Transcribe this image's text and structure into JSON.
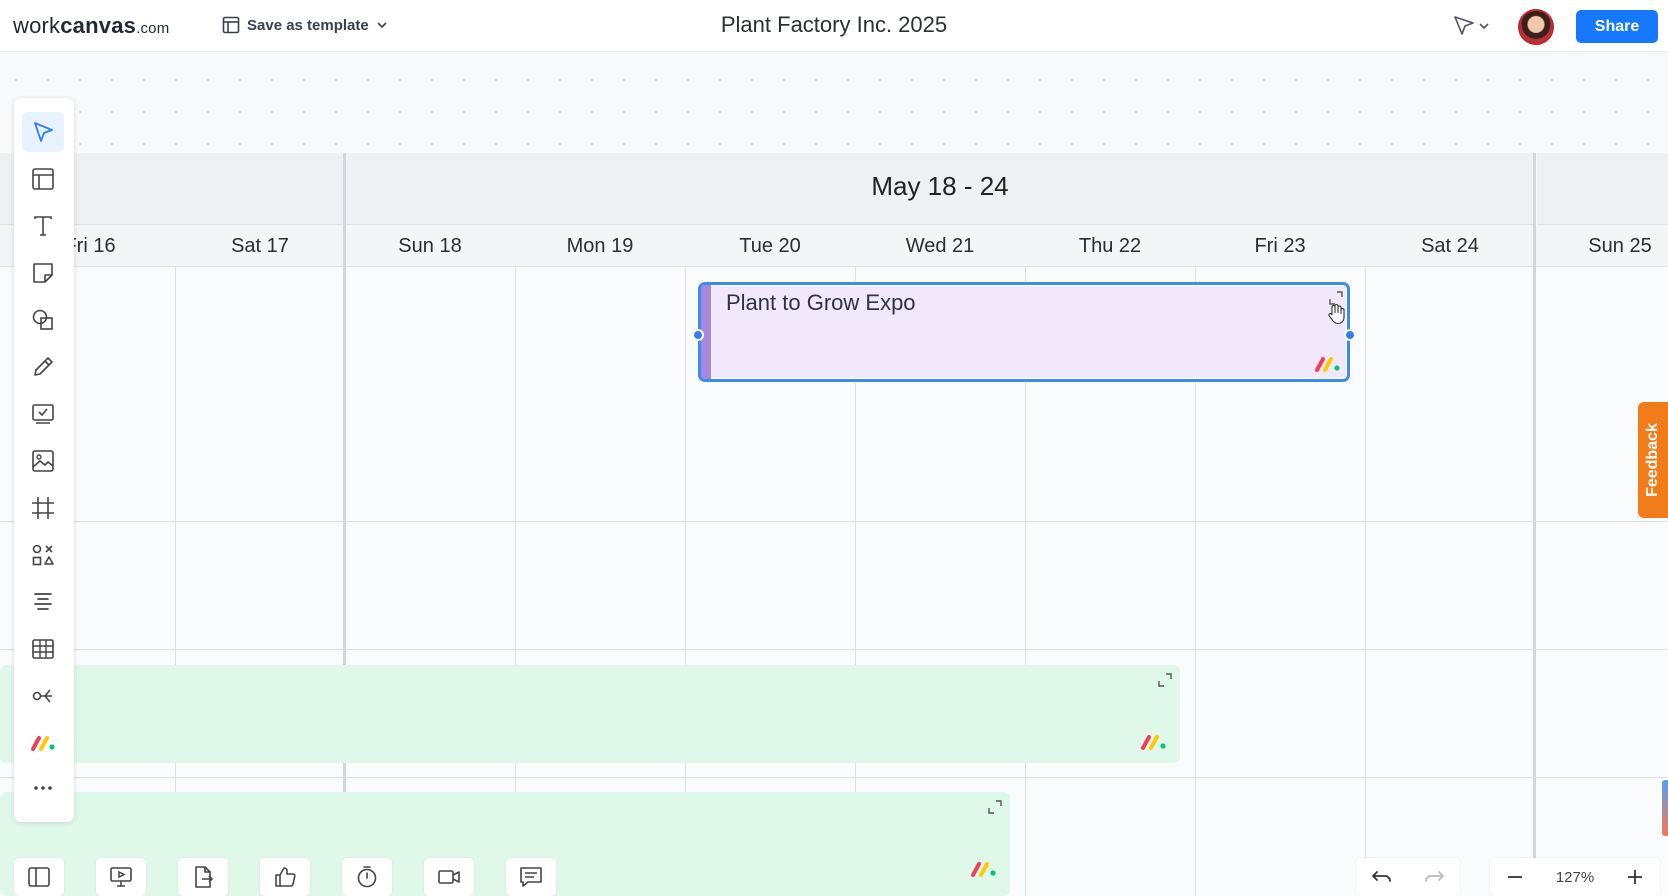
{
  "header": {
    "logo_main": "work",
    "logo_bold": "canvas",
    "logo_suffix": ".com",
    "save_template_label": "Save as template",
    "title": "Plant Factory Inc. 2025",
    "share_label": "Share"
  },
  "calendar": {
    "week_title": "May 18 - 24",
    "days": [
      "Fri 16",
      "Sat 17",
      "Sun 18",
      "Mon 19",
      "Tue 20",
      "Wed 21",
      "Thu 22",
      "Fri 23",
      "Sat 24",
      "Sun 25"
    ]
  },
  "events": {
    "selected": {
      "title": "Plant to Grow Expo",
      "color": "#f1e9fb",
      "accent": "#a987db"
    },
    "green_1": {
      "title": "",
      "color": "#dff8ea"
    },
    "green_2": {
      "title": "",
      "color": "#dff8ea"
    }
  },
  "toolbar": {
    "tools": [
      "select-icon",
      "template-icon",
      "text-icon",
      "sticky-note-icon",
      "shapes-icon",
      "pen-icon",
      "task-icon",
      "image-icon",
      "frame-icon",
      "diagram-shapes-icon",
      "align-icon",
      "table-icon",
      "mind-map-icon",
      "monday-icon",
      "more-icon"
    ]
  },
  "bottom": {
    "zoom": "127%",
    "tools": [
      "sidebar-icon",
      "present-icon",
      "export-icon",
      "vote-icon",
      "timer-icon",
      "video-icon",
      "comment-icon"
    ]
  },
  "feedback_label": "Feedback",
  "colors": {
    "accent": "#1677ff",
    "feedback": "#f27c1a",
    "selection": "#3b8cf0"
  }
}
